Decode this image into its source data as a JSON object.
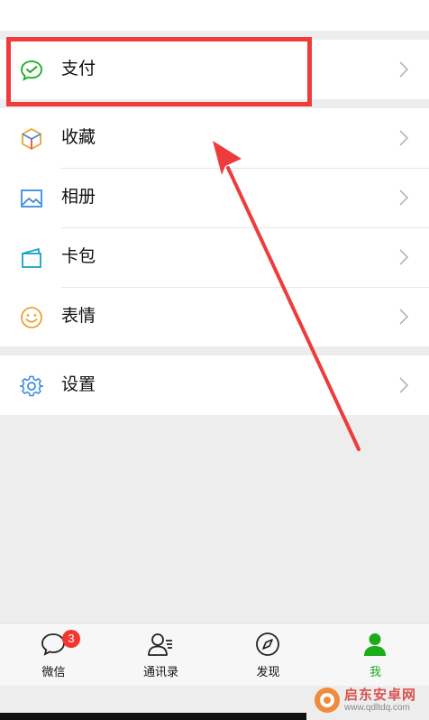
{
  "menu": {
    "pay": "支付",
    "favorites": "收藏",
    "album": "相册",
    "cards": "卡包",
    "stickers": "表情",
    "settings": "设置"
  },
  "tabbar": {
    "chats": "微信",
    "chats_badge": "3",
    "contacts": "通讯录",
    "discover": "发现",
    "me": "我"
  },
  "watermark": {
    "title": "启东安卓网",
    "url": "www.qdltdq.com"
  },
  "colors": {
    "accent_green": "#1aad19",
    "highlight_red": "#ee3b3b",
    "badge_red": "#f43530"
  }
}
